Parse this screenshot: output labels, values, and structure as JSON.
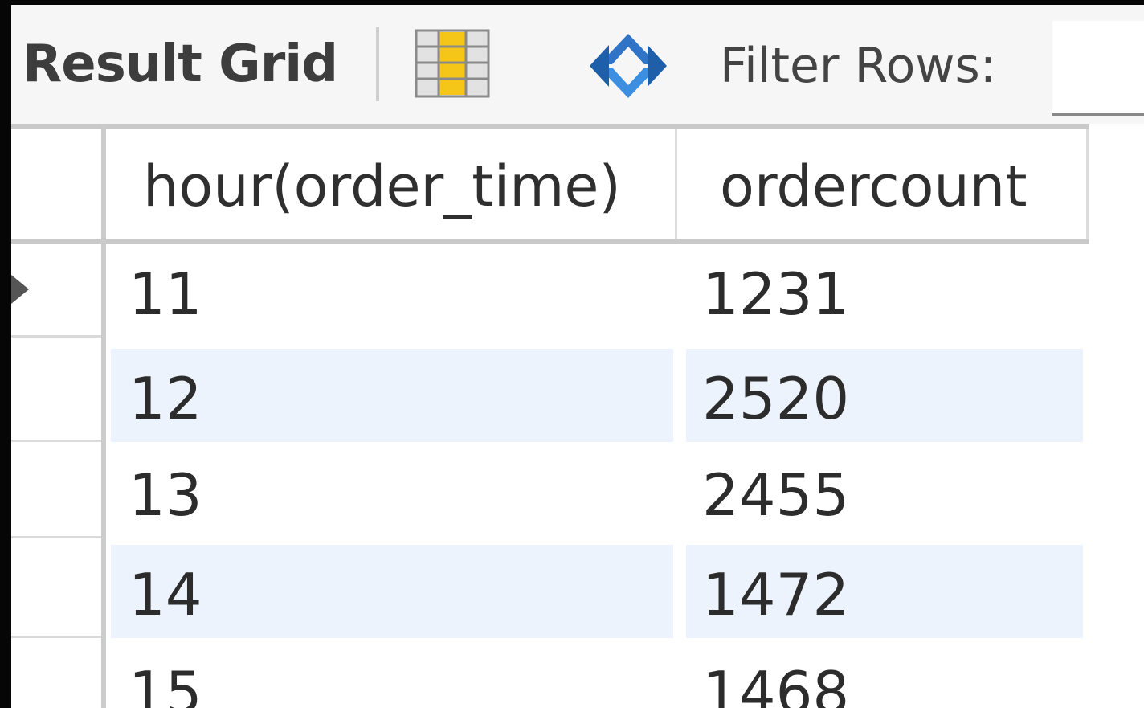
{
  "toolbar": {
    "title": "Result Grid",
    "grid_icon": "column-grid-icon",
    "refresh_icon": "refresh-icon",
    "filter_label": "Filter Rows:",
    "filter_value": ""
  },
  "grid": {
    "columns": [
      "hour(order_time)",
      "ordercount"
    ],
    "rows": [
      {
        "hour": "11",
        "count": "1231",
        "selected": true
      },
      {
        "hour": "12",
        "count": "2520"
      },
      {
        "hour": "13",
        "count": "2455"
      },
      {
        "hour": "14",
        "count": "1472"
      },
      {
        "hour": "15",
        "count": "1468"
      }
    ]
  },
  "colors": {
    "toolbar_bg": "#f6f6f6",
    "alt_row_bg": "#edf3fc",
    "text": "#2c2c2c",
    "grid_icon_fill": "#f5c518",
    "refresh_icon_fill": "#2f74c6"
  }
}
